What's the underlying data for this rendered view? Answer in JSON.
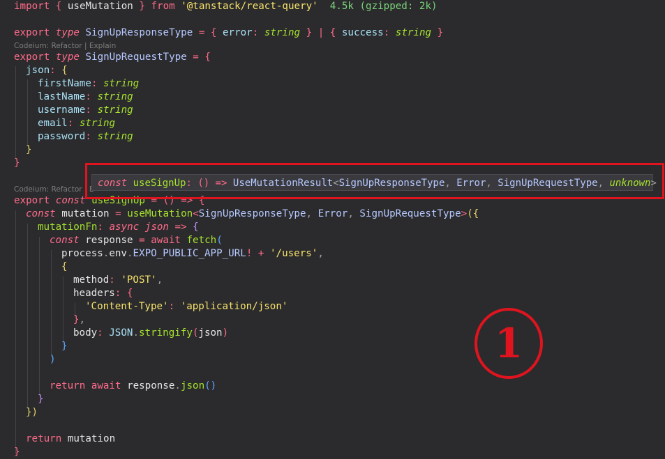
{
  "code": {
    "l1": {
      "import_kw": "import",
      "open": "{",
      "name": "useMutation",
      "close": "}",
      "from_kw": "from",
      "module": "'@tanstack/react-query'",
      "size_hint": "4.5k (gzipped: 2k)"
    },
    "l3": {
      "export": "export",
      "type": "type",
      "name": "SignUpResponseType",
      "eq": "=",
      "o1": "{",
      "k1": "error",
      "c1": ":",
      "t1": "string",
      "x1": "}",
      "pipe": "|",
      "o2": "{",
      "k2": "success",
      "c2": ":",
      "t2": "string",
      "x2": "}"
    },
    "lens1": "Codeium: Refactor | Explain",
    "l4": {
      "export": "export",
      "type": "type",
      "name": "SignUpRequestType",
      "eq": "=",
      "o": "{"
    },
    "l5": {
      "key": "json",
      "colon": ":",
      "o": "{"
    },
    "fields": [
      {
        "key": "firstName",
        "colon": ":",
        "type": "string"
      },
      {
        "key": "lastName",
        "colon": ":",
        "type": "string"
      },
      {
        "key": "username",
        "colon": ":",
        "type": "string"
      },
      {
        "key": "email",
        "colon": ":",
        "type": "string"
      },
      {
        "key": "password",
        "colon": ":",
        "type": "string"
      }
    ],
    "l11": "}",
    "l12": "}",
    "lens2": "Codeium: Refactor | E",
    "l14": {
      "export": "export",
      "const": "const",
      "name": "useSignUp",
      "rest": "= () => {"
    },
    "l15": {
      "const": "const",
      "name": "mutation",
      "eq": "=",
      "fn": "useMutation",
      "lt": "<",
      "a1": "SignUpResponseType",
      "cm1": ",",
      "a2": "Error",
      "cm2": ",",
      "a3": "SignUpRequestType",
      "gt": ">",
      "open": "({"
    },
    "l16": {
      "key": "mutationFn",
      "colon": ":",
      "async": "async",
      "param": "json",
      "arrow": "=>",
      "o": "{"
    },
    "l17": {
      "const": "const",
      "name": "response",
      "eq": "=",
      "await": "await",
      "fn": "fetch",
      "o": "("
    },
    "l18": {
      "obj": "process",
      "d1": ".",
      "env": "env",
      "d2": ".",
      "const": "EXPO_PUBLIC_APP_URL",
      "bang": "!",
      "plus": "+",
      "str": "'/users'",
      "cm": ","
    },
    "l19": "{",
    "l20": {
      "key": "method",
      "colon": ":",
      "val": "'POST'",
      "cm": ","
    },
    "l21": {
      "key": "headers",
      "colon": ":",
      "o": "{"
    },
    "l22": {
      "key": "'Content-Type'",
      "colon": ":",
      "val": "'application/json'"
    },
    "l23": {
      "c": "}",
      "cm": ","
    },
    "l24": {
      "key": "body",
      "colon": ":",
      "obj": "JSON",
      "dot": ".",
      "fn": "stringify",
      "o": "(",
      "arg": "json",
      "c": ")"
    },
    "l25": "}",
    "l26": ")",
    "l28": {
      "ret": "return",
      "await": "await",
      "obj": "response",
      "dot": ".",
      "fn": "json",
      "call": "()"
    },
    "l29": "}",
    "l30": "})",
    "l32": {
      "ret": "return",
      "name": "mutation"
    },
    "l33": "}"
  },
  "tooltip": {
    "const": "const",
    "name": "useSignUp",
    "colon": ":",
    "sig": "() =>",
    "type": "UseMutationResult",
    "lt": "<",
    "a1": "SignUpResponseType",
    "cm1": ",",
    "a2": "Error",
    "cm2": ",",
    "a3": "SignUpRequestType",
    "cm3": ",",
    "a4": "unknown",
    "gt": ">"
  },
  "annotation": {
    "label": "1",
    "color": "#e0141e"
  }
}
